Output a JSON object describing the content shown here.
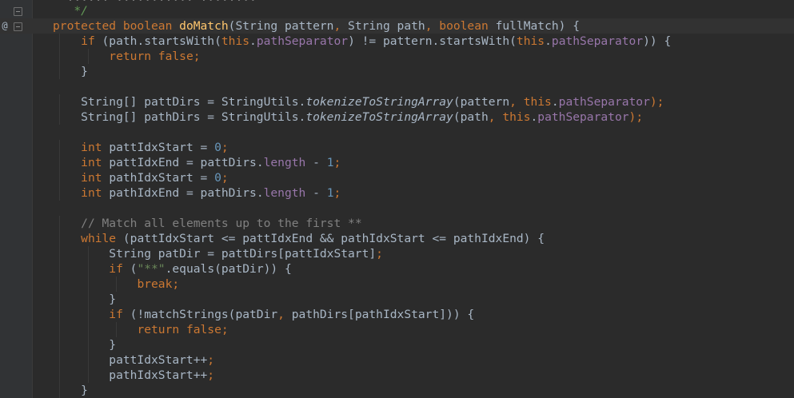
{
  "gutter": {
    "override_marker": "@"
  },
  "code": {
    "top_clip": "   * ...... ........... ........",
    "lines": [
      [
        {
          "t": "   */",
          "c": "d"
        }
      ],
      [
        {
          "t": "protected boolean ",
          "c": "k"
        },
        {
          "t": "doMatch",
          "c": "m"
        },
        {
          "t": "(String pattern"
        },
        {
          "t": ", ",
          "c": "k"
        },
        {
          "t": "String path"
        },
        {
          "t": ", ",
          "c": "k"
        },
        {
          "t": "boolean ",
          "c": "k"
        },
        {
          "t": "fullMatch) {"
        }
      ],
      [
        {
          "t": "    "
        },
        {
          "t": "if ",
          "c": "k"
        },
        {
          "t": "(path.startsWith("
        },
        {
          "t": "this",
          "c": "k"
        },
        {
          "t": "."
        },
        {
          "t": "pathSeparator",
          "c": "f"
        },
        {
          "t": ") != pattern.startsWith("
        },
        {
          "t": "this",
          "c": "k"
        },
        {
          "t": "."
        },
        {
          "t": "pathSeparator",
          "c": "f"
        },
        {
          "t": ")) {"
        }
      ],
      [
        {
          "t": "        "
        },
        {
          "t": "return false;",
          "c": "k"
        }
      ],
      [
        {
          "t": "    }"
        }
      ],
      [
        {
          "t": ""
        }
      ],
      [
        {
          "t": "    String[] pattDirs = StringUtils."
        },
        {
          "t": "tokenizeToStringArray",
          "c": "i"
        },
        {
          "t": "(pattern"
        },
        {
          "t": ", ",
          "c": "k"
        },
        {
          "t": "this",
          "c": "k"
        },
        {
          "t": "."
        },
        {
          "t": "pathSeparator",
          "c": "f"
        },
        {
          "t": ");",
          "c": "k"
        }
      ],
      [
        {
          "t": "    String[] pathDirs = StringUtils."
        },
        {
          "t": "tokenizeToStringArray",
          "c": "i"
        },
        {
          "t": "(path"
        },
        {
          "t": ", ",
          "c": "k"
        },
        {
          "t": "this",
          "c": "k"
        },
        {
          "t": "."
        },
        {
          "t": "pathSeparator",
          "c": "f"
        },
        {
          "t": ");",
          "c": "k"
        }
      ],
      [
        {
          "t": ""
        }
      ],
      [
        {
          "t": "    "
        },
        {
          "t": "int ",
          "c": "k"
        },
        {
          "t": "pattIdxStart = "
        },
        {
          "t": "0",
          "c": "n"
        },
        {
          "t": ";",
          "c": "k"
        }
      ],
      [
        {
          "t": "    "
        },
        {
          "t": "int ",
          "c": "k"
        },
        {
          "t": "pattIdxEnd = pattDirs."
        },
        {
          "t": "length",
          "c": "f"
        },
        {
          "t": " - "
        },
        {
          "t": "1",
          "c": "n"
        },
        {
          "t": ";",
          "c": "k"
        }
      ],
      [
        {
          "t": "    "
        },
        {
          "t": "int ",
          "c": "k"
        },
        {
          "t": "pathIdxStart = "
        },
        {
          "t": "0",
          "c": "n"
        },
        {
          "t": ";",
          "c": "k"
        }
      ],
      [
        {
          "t": "    "
        },
        {
          "t": "int ",
          "c": "k"
        },
        {
          "t": "pathIdxEnd = pathDirs."
        },
        {
          "t": "length",
          "c": "f"
        },
        {
          "t": " - "
        },
        {
          "t": "1",
          "c": "n"
        },
        {
          "t": ";",
          "c": "k"
        }
      ],
      [
        {
          "t": ""
        }
      ],
      [
        {
          "t": "    "
        },
        {
          "t": "// Match all elements up to the first **",
          "c": "c"
        }
      ],
      [
        {
          "t": "    "
        },
        {
          "t": "while ",
          "c": "k"
        },
        {
          "t": "(pattIdxStart <= pattIdxEnd && pathIdxStart <= pathIdxEnd) {"
        }
      ],
      [
        {
          "t": "        String patDir = pattDirs[pattIdxStart]"
        },
        {
          "t": ";",
          "c": "k"
        }
      ],
      [
        {
          "t": "        "
        },
        {
          "t": "if ",
          "c": "k"
        },
        {
          "t": "("
        },
        {
          "t": "\"**\"",
          "c": "s"
        },
        {
          "t": ".equals(patDir)) {"
        }
      ],
      [
        {
          "t": "            "
        },
        {
          "t": "break;",
          "c": "k"
        }
      ],
      [
        {
          "t": "        }"
        }
      ],
      [
        {
          "t": "        "
        },
        {
          "t": "if ",
          "c": "k"
        },
        {
          "t": "(!matchStrings(patDir"
        },
        {
          "t": ", ",
          "c": "k"
        },
        {
          "t": "pathDirs[pathIdxStart])) {"
        }
      ],
      [
        {
          "t": "            "
        },
        {
          "t": "return false;",
          "c": "k"
        }
      ],
      [
        {
          "t": "        }"
        }
      ],
      [
        {
          "t": "        pattIdxStart++"
        },
        {
          "t": ";",
          "c": "k"
        }
      ],
      [
        {
          "t": "        pathIdxStart++"
        },
        {
          "t": ";",
          "c": "k"
        }
      ],
      [
        {
          "t": "    }"
        }
      ]
    ]
  }
}
